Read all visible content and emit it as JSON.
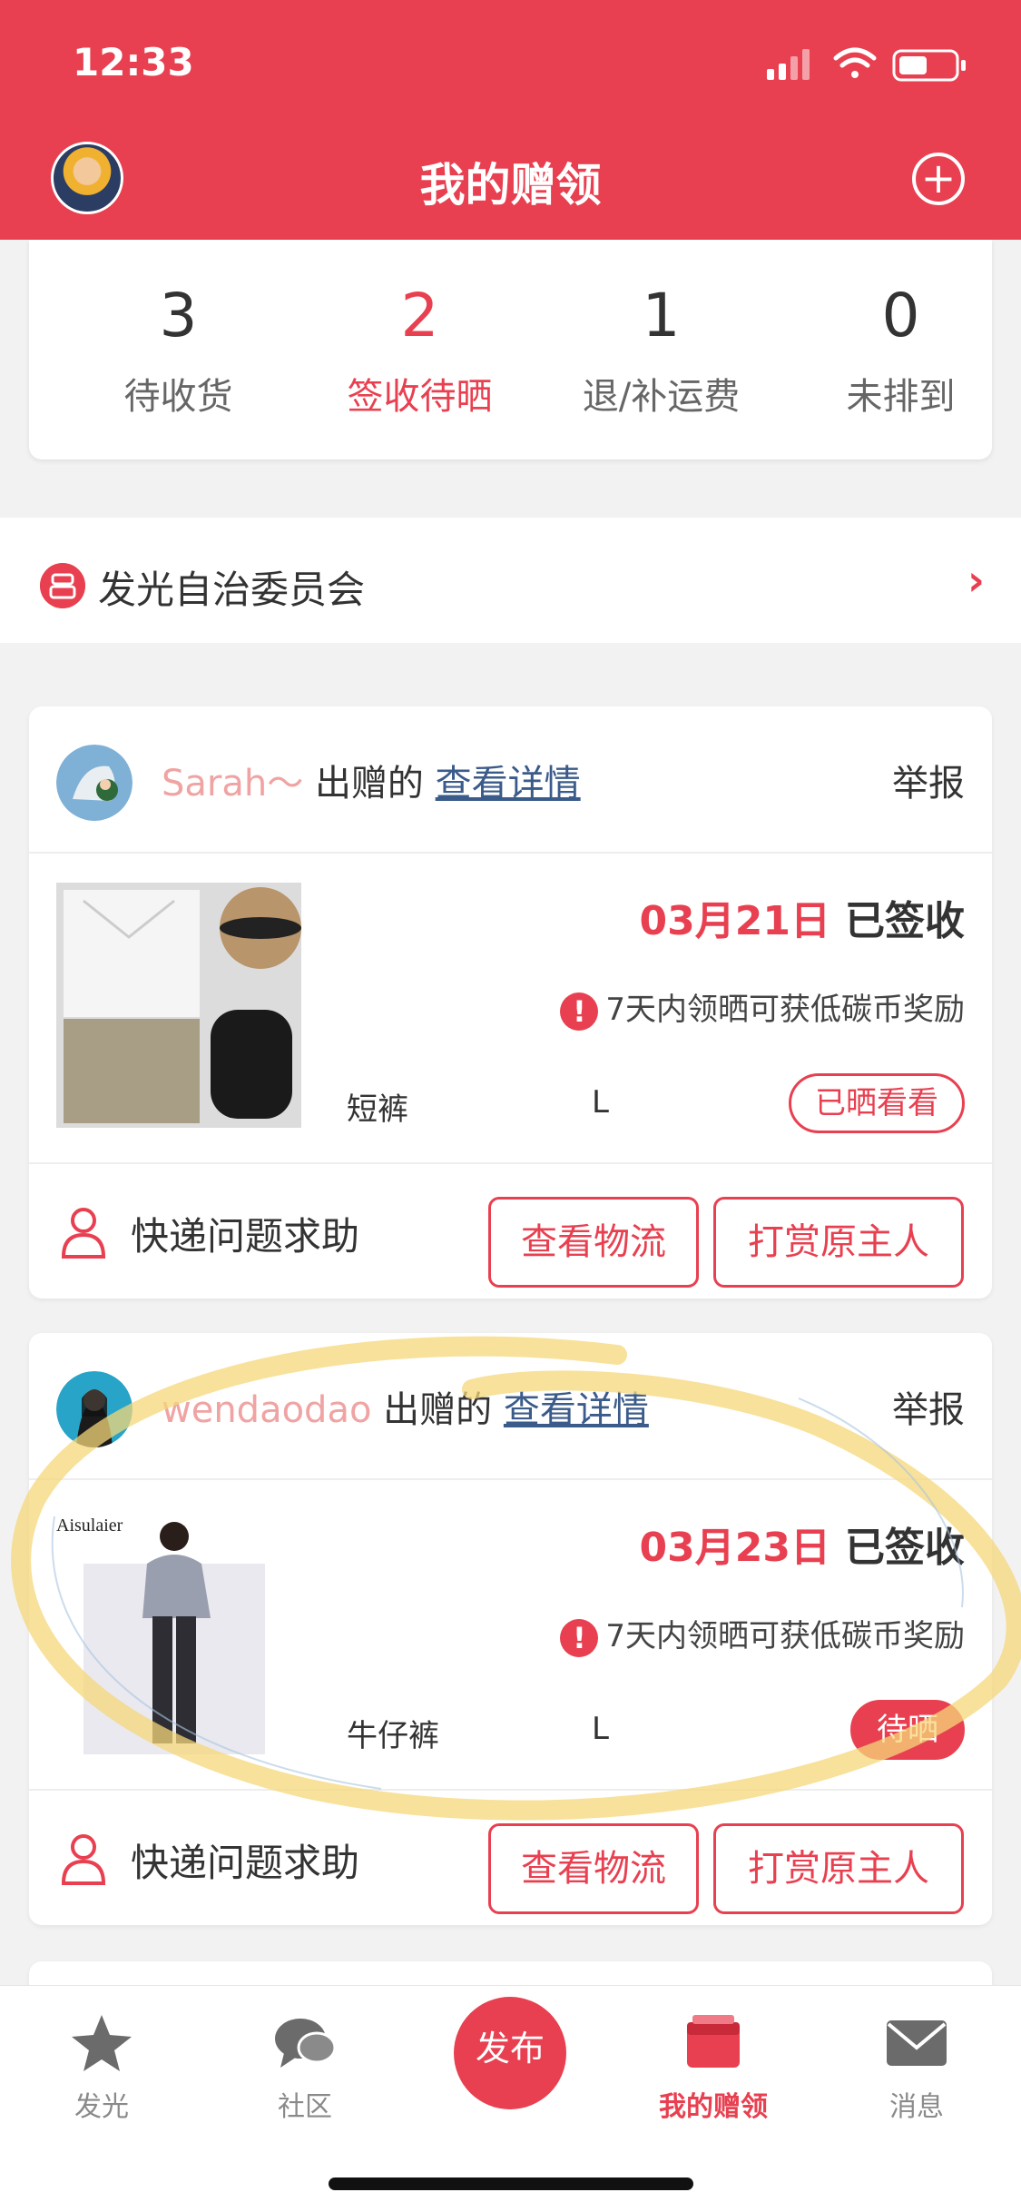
{
  "status_bar": {
    "time": "12:33"
  },
  "header": {
    "title": "我的赠领"
  },
  "stats": [
    {
      "count": "3",
      "label": "待收货"
    },
    {
      "count": "2",
      "label": "签收待晒"
    },
    {
      "count": "1",
      "label": "退/补运费"
    },
    {
      "count": "0",
      "label": "未排到"
    }
  ],
  "committee": {
    "label": "发光自治委员会"
  },
  "cards": [
    {
      "donor": "Sarah～",
      "donated_text": "出赠的",
      "detail_link": "查看详情",
      "report": "举报",
      "date": "03月21日",
      "status_text": "已签收",
      "notice": "7天内领晒可获低碳币奖励",
      "item_name": "短裤",
      "item_size": "L",
      "pill": "已晒看看",
      "help": "快递问题求助",
      "btn_logistics": "查看物流",
      "btn_tip": "打赏原主人"
    },
    {
      "donor": "wendaodao",
      "donated_text": "出赠的",
      "detail_link": "查看详情",
      "report": "举报",
      "date": "03月23日",
      "status_text": "已签收",
      "notice": "7天内领晒可获低碳币奖励",
      "item_name": "牛仔裤",
      "item_size": "L",
      "pill": "待晒",
      "help": "快递问题求助",
      "btn_logistics": "查看物流",
      "btn_tip": "打赏原主人",
      "thumb_brand": "Aisulaier"
    }
  ],
  "tabbar": {
    "tabs": [
      {
        "label": "发光",
        "icon": "star-icon"
      },
      {
        "label": "社区",
        "icon": "chat-icon"
      },
      {
        "label": "我的赠领",
        "icon": "gift-box-icon"
      },
      {
        "label": "消息",
        "icon": "mail-icon"
      }
    ],
    "publish": "发布"
  },
  "colors": {
    "accent": "#e84050",
    "donor_name": "#f0a3a3",
    "link": "#3b5b8a",
    "highlight": "#f6d77a"
  }
}
